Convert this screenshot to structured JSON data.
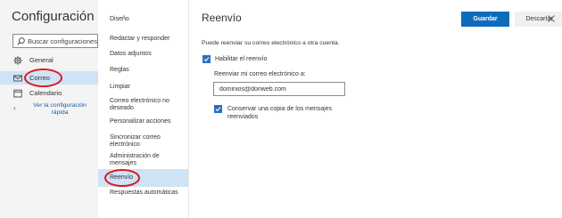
{
  "settings": {
    "title": "Configuración",
    "search": {
      "placeholder": "Buscar configuraciones",
      "icon": "search-icon"
    },
    "nav": [
      {
        "label": "General",
        "icon": "gear-icon",
        "selected": false
      },
      {
        "label": "Correo",
        "icon": "mail-icon",
        "selected": true
      },
      {
        "label": "Calendario",
        "icon": "calendar-icon",
        "selected": false
      }
    ],
    "quick_link": {
      "label": "Ver la configuración rápida",
      "icon": "chevron-left-icon"
    }
  },
  "categories": [
    {
      "label": "Diseño",
      "selected": false
    },
    {
      "label": "Redactar y responder",
      "selected": false
    },
    {
      "label": "Datos adjuntos",
      "selected": false
    },
    {
      "label": "Reglas",
      "selected": false
    },
    {
      "label": "Limpiar",
      "selected": false
    },
    {
      "label": "Correo electrónico no deseado",
      "selected": false
    },
    {
      "label": "Personalizar acciones",
      "selected": false
    },
    {
      "label": "Sincronizar correo electrónico",
      "selected": false
    },
    {
      "label": "Administración de mensajes",
      "selected": false
    },
    {
      "label": "Reenvío",
      "selected": true
    },
    {
      "label": "Respuestas automáticas",
      "selected": false
    }
  ],
  "content": {
    "title": "Reenvío",
    "save_label": "Guardar",
    "discard_label": "Descartar",
    "close_icon": "close-icon",
    "description": "Puede reenviar su correo electrónico a otra cuenta.",
    "enable_forwarding": {
      "label": "Habilitar el reenvío",
      "checked": true
    },
    "forward_to_label": "Reenviar mi correo electrónico a:",
    "forward_to_value": "dominios@donweb.com",
    "keep_copy": {
      "label": "Conservar una copia de los mensajes reenviados",
      "checked": true
    }
  },
  "colors": {
    "accent": "#0f6cbd",
    "selected_background": "#cfe3f6",
    "left_pane_background": "#f4f4f4",
    "highlight_oval": "#e0161a",
    "checkbox": "#2b6fc0",
    "link": "#0f5fa8"
  }
}
